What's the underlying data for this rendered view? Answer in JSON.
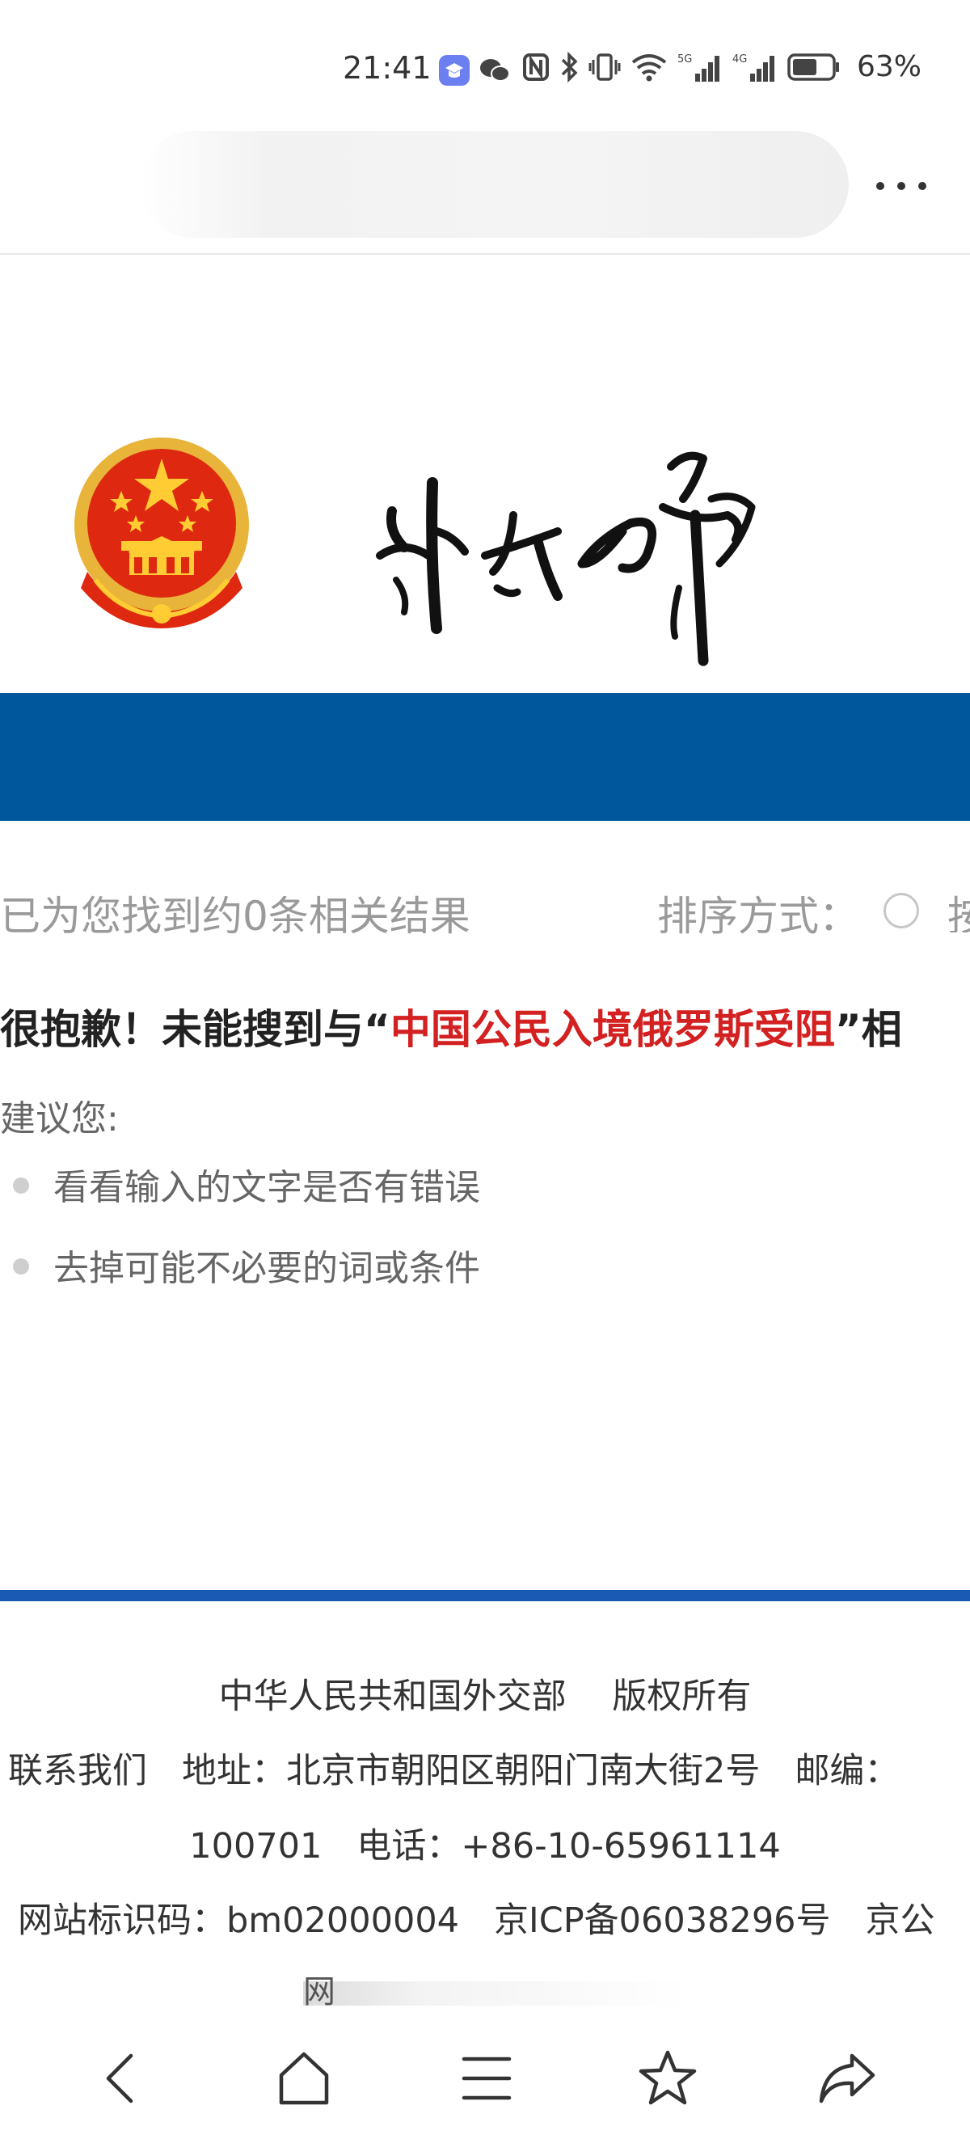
{
  "status_bar": {
    "time": "21:41",
    "battery_percent": "63%",
    "battery_level": 0.63,
    "icons": [
      "study-app-icon",
      "wechat-icon",
      "nfc-icon",
      "bluetooth-icon",
      "vibrate-icon",
      "wifi-icon",
      "signal-5g-icon",
      "signal-4g-icon",
      "battery-icon"
    ],
    "labels": {
      "g5": "5G",
      "g4": "4G"
    }
  },
  "browser": {
    "url_blurred": true,
    "more_icon": "more-dots-icon"
  },
  "header": {
    "emblem_icon": "national-emblem-icon",
    "calligraphy_icon": "waijiaobu-calligraphy-icon",
    "band_color": "#00579b"
  },
  "results": {
    "summary": "已为您找到约0条相关结果",
    "sort_label": "排序方式：",
    "sort_option_partial": "按",
    "sorry_prefix": "很抱歉！未能搜到与“",
    "query": "中国公民入境俄罗斯受阻",
    "sorry_suffix": "”相",
    "suggest_title": "建议您:",
    "suggestions": [
      "看看输入的文字是否有错误",
      "去掉可能不必要的词或条件"
    ],
    "accent_color": "#d32020"
  },
  "footer": {
    "line1": "中华人民共和国外交部　 版权所有",
    "line2": "联系我们　地址：北京市朝阳区朝阳门南大街2号　邮编：",
    "line3": "100701　电话：+86-10-65961114",
    "line4": "网站标识码：bm02000004　京ICP备06038296号　京公",
    "line5_partial": "网",
    "rule_color": "#1a5ab4"
  },
  "bottom_nav": {
    "items": [
      "back-icon",
      "home-icon",
      "menu-icon",
      "bookmark-star-icon",
      "share-icon"
    ]
  }
}
